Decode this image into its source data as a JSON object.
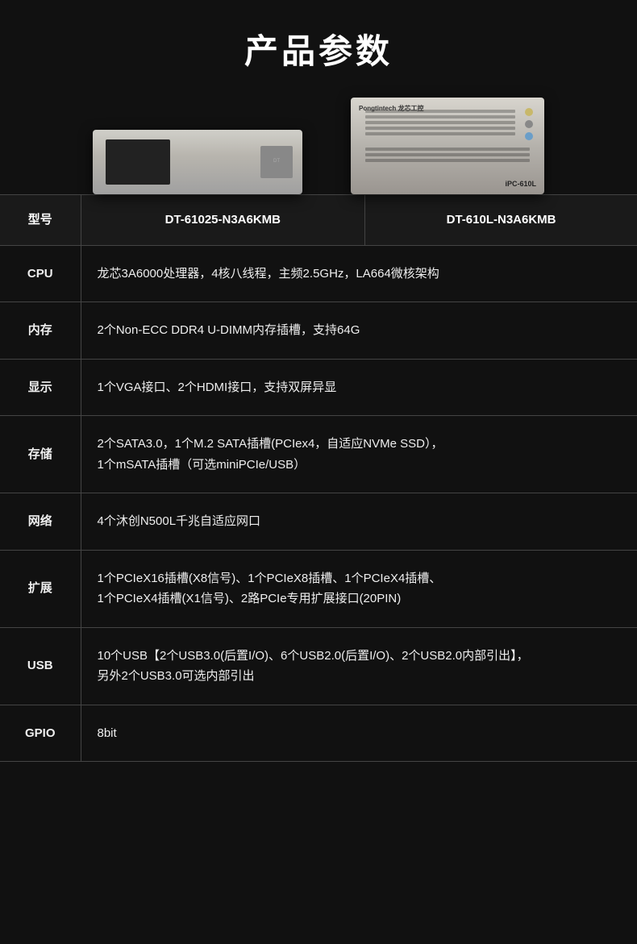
{
  "page": {
    "title": "产品参数",
    "background": "#111"
  },
  "products": [
    {
      "model": "DT-61025-N3A6KMB",
      "type": "2u-rack"
    },
    {
      "model": "DT-610L-N3A6KMB",
      "type": "4u-rack"
    }
  ],
  "table": {
    "header": {
      "label": "型号",
      "model1": "DT-61025-N3A6KMB",
      "model2": "DT-610L-N3A6KMB"
    },
    "rows": [
      {
        "label": "CPU",
        "value": "龙芯3A6000处理器，4核八线程，主频2.5GHz，LA664微核架构"
      },
      {
        "label": "内存",
        "value": "2个Non-ECC DDR4 U-DIMM内存插槽，支持64G"
      },
      {
        "label": "显示",
        "value": "1个VGA接口、2个HDMI接口，支持双屏异显"
      },
      {
        "label": "存储",
        "value": "2个SATA3.0，1个M.2 SATA插槽(PCIex4，自适应NVMe SSD），\n1个mSATA插槽（可选miniPCIe/USB）"
      },
      {
        "label": "网络",
        "value": "4个沐创N500L千兆自适应网口"
      },
      {
        "label": "扩展",
        "value": "1个PCIeX16插槽(X8信号)、1个PCIeX8插槽、1个PCIeX4插槽、\n1个PCIeX4插槽(X1信号)、2路PCIe专用扩展接口(20PIN)"
      },
      {
        "label": "USB",
        "value": "10个USB【2个USB3.0(后置I/O)、6个USB2.0(后置I/O)、2个USB2.0内部引出】，\n另外2个USB3.0可选内部引出"
      },
      {
        "label": "GPIO",
        "value": "8bit"
      }
    ]
  }
}
